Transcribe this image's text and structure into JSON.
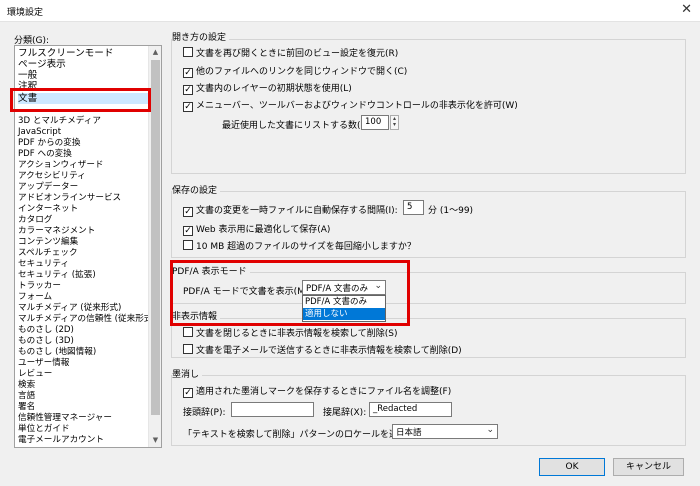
{
  "window": {
    "title": "環境設定",
    "close_glyph": "✕"
  },
  "categories": {
    "label": "分類(G):",
    "top": [
      "フルスクリーンモード",
      "ページ表示",
      "一般",
      "注釈",
      "文書"
    ],
    "items": [
      "3D とマルチメディア",
      "JavaScript",
      "PDF からの変換",
      "PDF への変換",
      "アクションウィザード",
      "アクセシビリティ",
      "アップデーター",
      "アドビオンラインサービス",
      "インターネット",
      "カタログ",
      "カラーマネジメント",
      "コンテンツ編集",
      "スペルチェック",
      "セキュリティ",
      "セキュリティ (拡張)",
      "トラッカー",
      "フォーム",
      "マルチメディア (従来形式)",
      "マルチメディアの信頼性 (従来形式)",
      "ものさし (2D)",
      "ものさし (3D)",
      "ものさし (地図情報)",
      "ユーザー情報",
      "レビュー",
      "検索",
      "言語",
      "署名",
      "信頼性管理マネージャー",
      "単位とガイド",
      "電子メールアカウント"
    ],
    "selected": "文書"
  },
  "open_settings": {
    "title": "開き方の設定",
    "options": [
      {
        "label": "文書を再び開くときに前回のビュー設定を復元(R)",
        "checked": false
      },
      {
        "label": "他のファイルへのリンクを同じウィンドウで開く(C)",
        "checked": true
      },
      {
        "label": "文書内のレイヤーの初期状態を使用(L)",
        "checked": true
      },
      {
        "label": "メニューバー、ツールバーおよびウィンドウコントロールの非表示化を許可(W)",
        "checked": true
      }
    ],
    "recent_label": "最近使用した文書にリストする数(U):",
    "recent_value": "100"
  },
  "save_settings": {
    "title": "保存の設定",
    "autosave_label": "文書の変更を一時ファイルに自動保存する間隔(I):",
    "autosave_value": "5",
    "autosave_unit": "分 (1〜99)",
    "options": [
      {
        "label": "文書の変更を一時ファイルに自動保存する間隔(I):",
        "checked": true
      },
      {
        "label": "Web 表示用に最適化して保存(A)",
        "checked": true
      },
      {
        "label": "10 MB 超過のファイルのサイズを毎回縮小しますか？",
        "checked": false
      }
    ]
  },
  "pdfa": {
    "title": "PDF/A 表示モード",
    "label": "PDF/A モードで文書を表示(M):",
    "selected": "PDF/A 文書のみ",
    "options": [
      "PDF/A 文書のみ",
      "適用しない"
    ],
    "highlighted": "適用しない"
  },
  "hidden_info": {
    "title": "非表示情報",
    "options": [
      {
        "label": "文書を閉じるときに非表示情報を検索して削除(S)",
        "checked": false
      },
      {
        "label": "文書を電子メールで送信するときに非表示情報を検索して削除(D)",
        "checked": false
      }
    ]
  },
  "redaction": {
    "title": "墨消し",
    "option": {
      "label": "適用された墨消しマークを保存するときにファイル名を調整(F)",
      "checked": true
    },
    "prefix_label": "接頭辞(P):",
    "prefix_value": "",
    "suffix_label": "接尾辞(X):",
    "suffix_value": "_Redacted",
    "locale_label": "「テキストを検索して削除」パターンのロケールを選択(H):",
    "locale_value": "日本語"
  },
  "buttons": {
    "ok": "OK",
    "cancel": "キャンセル"
  },
  "glyphs": {
    "check": "✓",
    "chevron": "⌄",
    "up": "▲",
    "down": "▼"
  },
  "colors": {
    "highlight": "#0078d7",
    "annotation_red": "#e00000",
    "selection": "#cde8ff"
  }
}
